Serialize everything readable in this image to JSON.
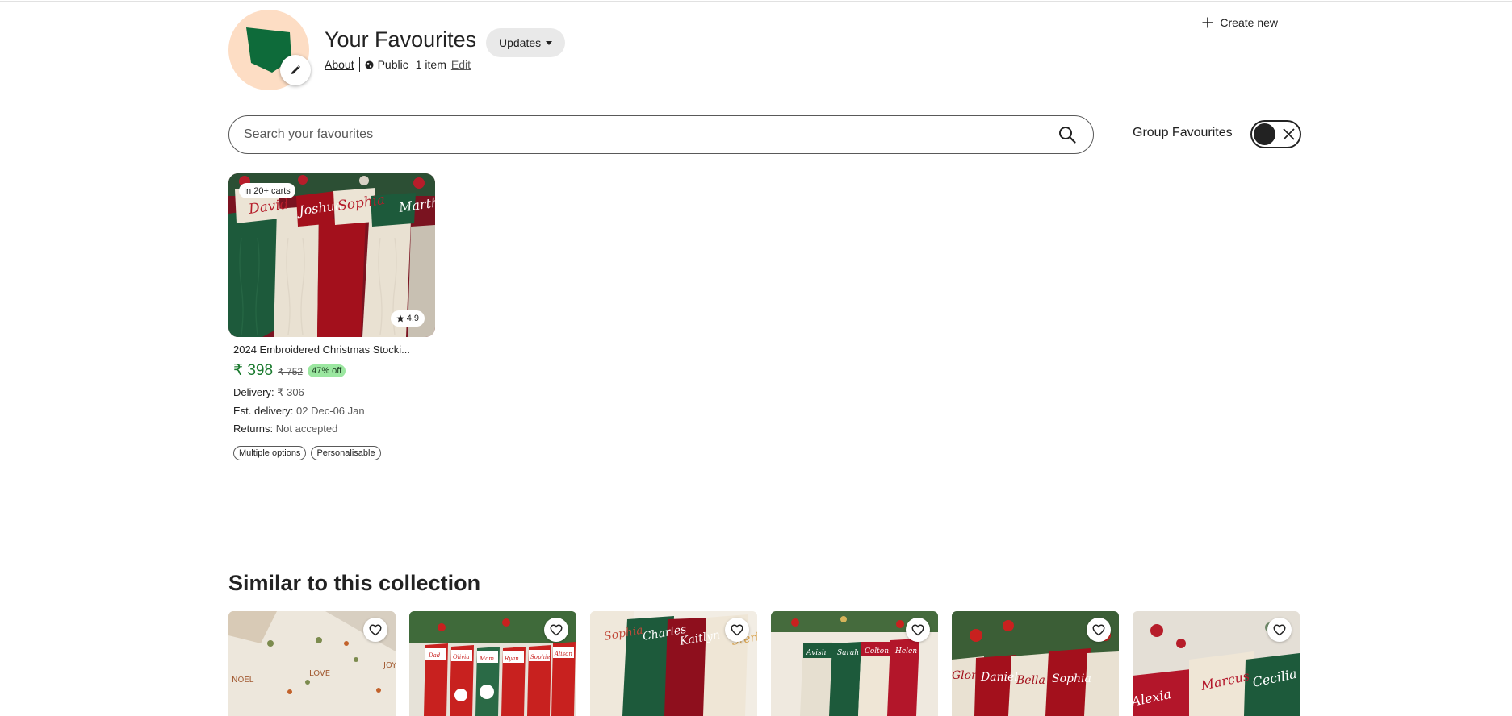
{
  "header": {
    "title": "Your Favourites",
    "updates_label": "Updates",
    "about_label": "About",
    "visibility": "Public",
    "item_count": "1 item",
    "edit_label": "Edit",
    "create_new_label": "Create new",
    "avatar_bg_color": "#fdddc4",
    "avatar_shape_color": "#0e6b3a"
  },
  "search": {
    "placeholder": "Search your favourites",
    "value": ""
  },
  "group_favourites": {
    "label": "Group Favourites",
    "enabled": false
  },
  "listing": {
    "carts_badge": "In 20+ carts",
    "rating": "4.9",
    "title": "2024 Embroidered Christmas Stocki...",
    "price": "₹ 398",
    "original_price": "₹ 752",
    "discount": "47% off",
    "delivery_label": "Delivery:",
    "delivery_value": "₹ 306",
    "est_delivery_label": "Est. delivery:",
    "est_delivery_value": "02 Dec-06 Jan",
    "returns_label": "Returns:",
    "returns_value": "Not accepted",
    "tags": [
      "Multiple options",
      "Personalisable"
    ],
    "image_names": [
      "David",
      "Joshua",
      "Sophia",
      "Martha"
    ]
  },
  "similar": {
    "title": "Similar to this collection",
    "items": [
      {
        "names": [
          "NOEL",
          "LOVE",
          "JOY"
        ]
      },
      {
        "names": [
          "Dad",
          "Olivia",
          "Mom",
          "Ryan",
          "Sophie",
          "Alison"
        ]
      },
      {
        "names": [
          "Sophia",
          "Charles",
          "Kaitlyn",
          "Sterling"
        ]
      },
      {
        "names": [
          "Avish",
          "Sarah",
          "Colton",
          "Helen"
        ]
      },
      {
        "names": [
          "Gloria",
          "Daniel",
          "Bella",
          "Sophia"
        ]
      },
      {
        "names": [
          "Alexia",
          "Marcus",
          "Cecilia"
        ]
      }
    ]
  },
  "colors": {
    "price_green": "#1a7a2e",
    "discount_bg": "#9be7a0",
    "stocking_green": "#1d5a3b",
    "stocking_red": "#a3101c",
    "stocking_cream": "#ece4d5"
  },
  "icons": {
    "edit": "pencil-icon",
    "globe": "globe-icon",
    "create": "plus-icon",
    "search": "search-icon",
    "toggle": "close-icon",
    "rating": "star-icon",
    "favourite": "heart-icon"
  }
}
